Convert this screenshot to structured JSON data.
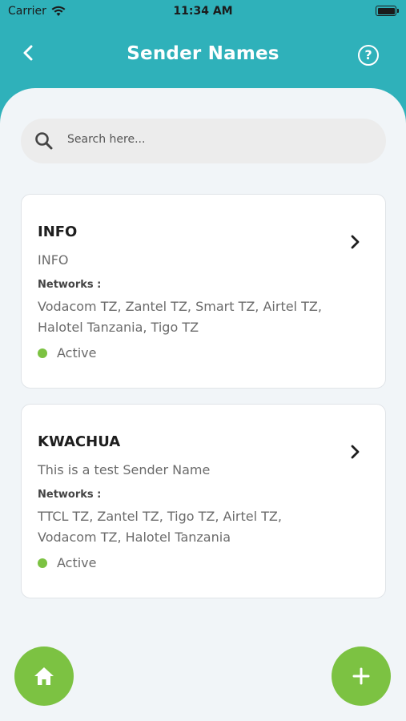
{
  "status_bar": {
    "carrier": "Carrier",
    "time": "11:34 AM"
  },
  "header": {
    "title": "Sender Names",
    "help": "?"
  },
  "search": {
    "placeholder": "Search here..."
  },
  "cards": [
    {
      "name": "INFO",
      "description": "INFO",
      "networks_label": "Networks :",
      "networks": "Vodacom TZ, Zantel TZ, Smart TZ, Airtel TZ, Halotel Tanzania, Tigo TZ",
      "status": "Active"
    },
    {
      "name": "KWACHUA",
      "description": "This is a test Sender Name",
      "networks_label": "Networks :",
      "networks": "TTCL TZ, Zantel TZ, Tigo TZ, Airtel TZ, Vodacom TZ, Halotel Tanzania",
      "status": "Active"
    }
  ],
  "icons": {
    "back": "chevron-left-icon",
    "help": "help-circle-icon",
    "search": "search-icon",
    "chevron": "chevron-right-icon",
    "home": "home-icon",
    "add": "plus-icon",
    "wifi": "wifi-icon",
    "battery": "battery-icon"
  },
  "colors": {
    "header_bg": "#2fb1ba",
    "sheet_bg": "#f1f5f8",
    "accent_green": "#7cc242",
    "status_active": "#7cc242"
  }
}
